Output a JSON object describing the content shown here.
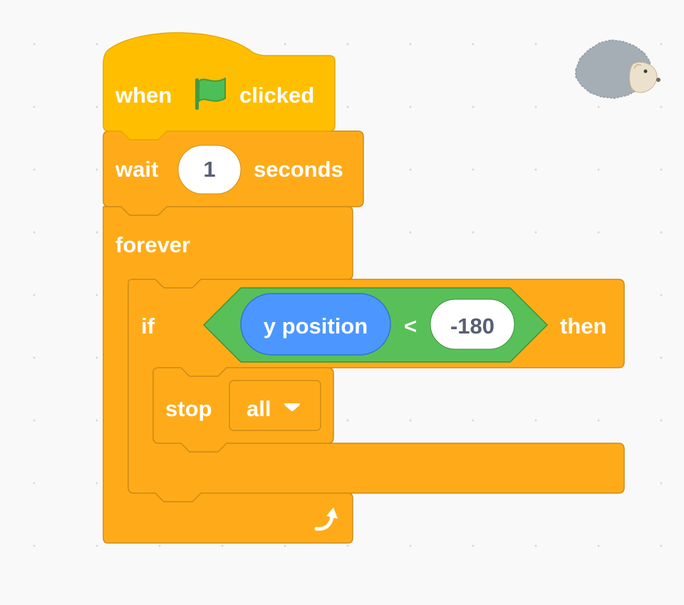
{
  "colors": {
    "events": "#ffbf00",
    "events_stroke": "#e6a800",
    "control": "#ffab19",
    "control_stroke": "#cf8b17",
    "operators": "#59c059",
    "operators_stroke": "#389438",
    "motion": "#4c97ff",
    "motion_stroke": "#3373cc",
    "flag": "#4cbf56",
    "workspace": "#f9f9f9"
  },
  "sprite": {
    "icon": "hedgehog-sprite-icon"
  },
  "script": {
    "hat": {
      "word_when": "when",
      "icon": "green-flag-icon",
      "word_clicked": "clicked"
    },
    "wait": {
      "word_wait": "wait",
      "value": "1",
      "word_seconds": "seconds"
    },
    "forever": {
      "label": "forever",
      "icon": "loop-arrow-icon"
    },
    "if_block": {
      "word_if": "if",
      "word_then": "then",
      "condition": {
        "reporter": "y position",
        "operator": "<",
        "value": "-180"
      }
    },
    "stop": {
      "word_stop": "stop",
      "option": "all",
      "dropdown_icon": "dropdown-caret-icon"
    }
  }
}
